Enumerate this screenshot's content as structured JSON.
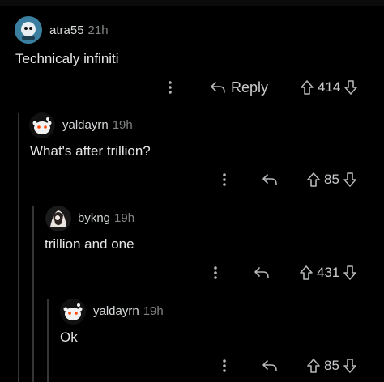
{
  "comments": [
    {
      "username": "atra55",
      "time": "21h",
      "text": "Technicaly infiniti",
      "reply_label": "Reply",
      "score": "414"
    },
    {
      "username": "yaldayrn",
      "time": "19h",
      "text": "What's after trillion?",
      "score": "85"
    },
    {
      "username": "bykng",
      "time": "19h",
      "text": "trillion and one",
      "score": "431"
    },
    {
      "username": "yaldayrn",
      "time": "19h",
      "text": "Ok",
      "score": "85"
    }
  ],
  "icons": {
    "more": "more-options-icon",
    "reply": "reply-arrow-icon",
    "upvote": "upvote-arrow-icon",
    "downvote": "downvote-arrow-icon"
  },
  "colors": {
    "background": "#000000",
    "text": "#d7dadc",
    "meta": "#818384",
    "thread_line": "#343536"
  }
}
